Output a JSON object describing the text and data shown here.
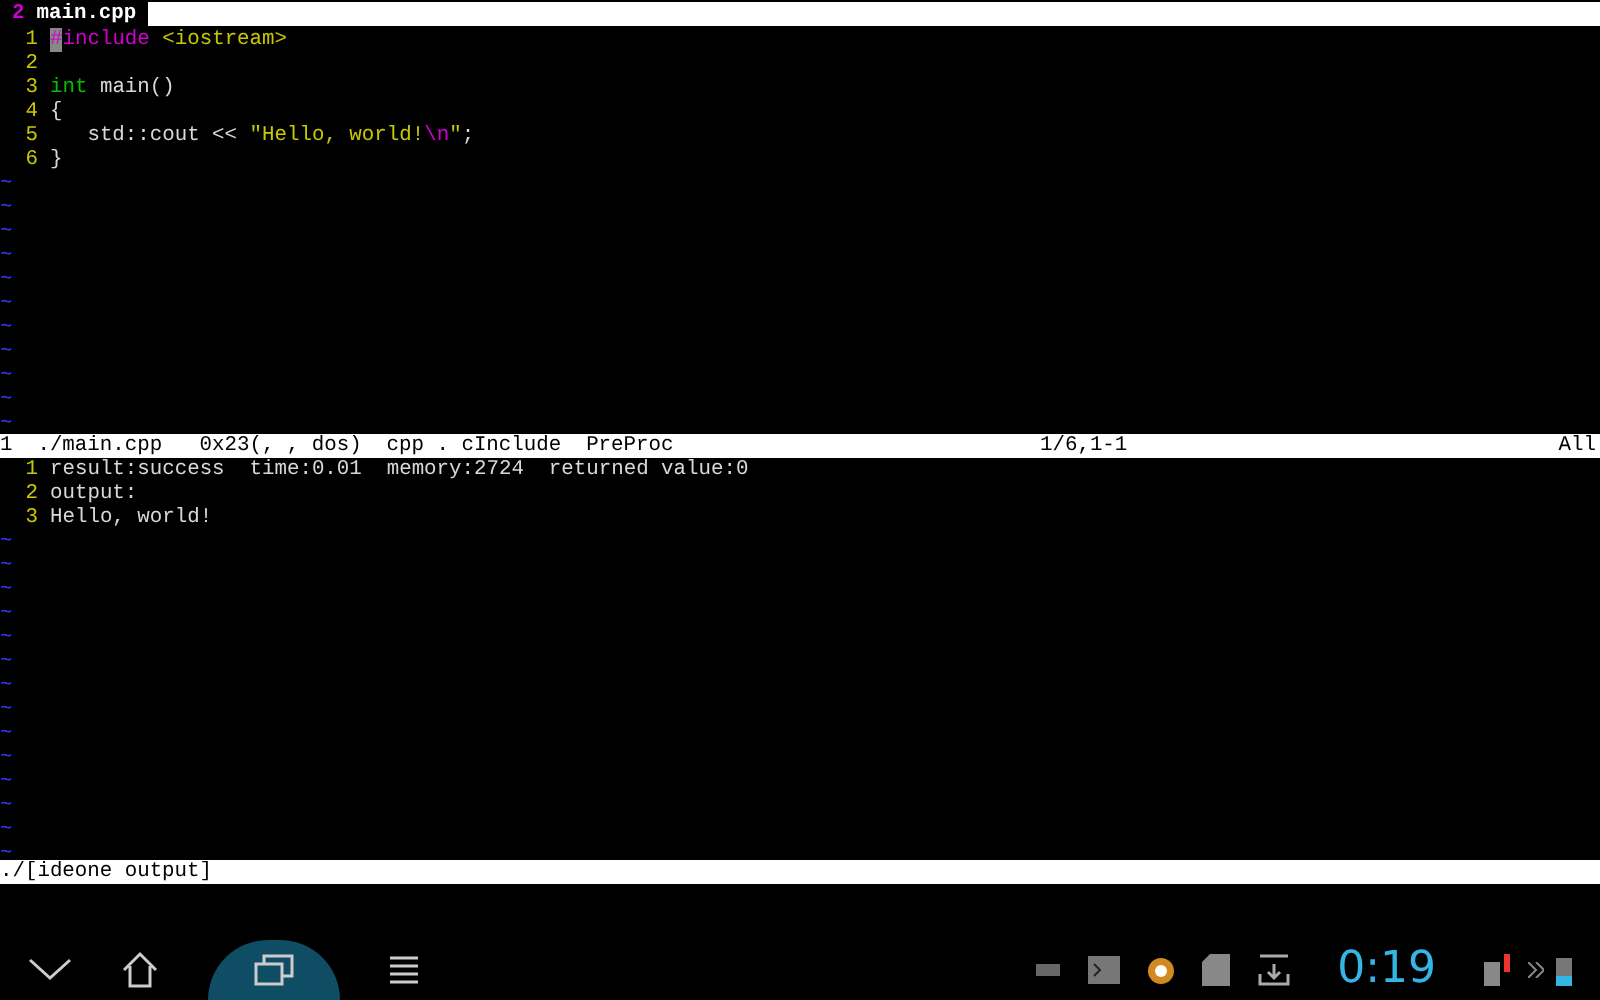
{
  "tabline": {
    "count": "2",
    "filename": "main.cpp"
  },
  "editor": {
    "lines": [
      {
        "number": "1",
        "segments": [
          {
            "kind": "cursor",
            "text": "#"
          },
          {
            "kind": "preproc",
            "text": "include"
          },
          {
            "kind": "string",
            "text": " <iostream>"
          }
        ]
      },
      {
        "number": "2"
      },
      {
        "number": "3",
        "segments": [
          {
            "kind": "type",
            "text": "int"
          },
          {
            "kind": "normal",
            "text": " main()"
          }
        ]
      },
      {
        "number": "4",
        "segments": [
          {
            "kind": "normal",
            "text": "{"
          }
        ]
      },
      {
        "number": "5",
        "segments": [
          {
            "kind": "normal",
            "text": "   std::cout << "
          },
          {
            "kind": "string",
            "text": "\"Hello, world!"
          },
          {
            "kind": "preproc",
            "text": "\\n"
          },
          {
            "kind": "string",
            "text": "\""
          },
          {
            "kind": "normal",
            "text": ";"
          }
        ]
      },
      {
        "number": "6",
        "segments": [
          {
            "kind": "normal",
            "text": "}"
          }
        ]
      }
    ],
    "filler": [
      "~",
      "~",
      "~",
      "~",
      "~",
      "~",
      "~",
      "~",
      "~",
      "~",
      "~"
    ],
    "status": {
      "buffer": "1",
      "file": "./main.cpp",
      "format": "0x23(, , dos)",
      "filetype": "cpp . cInclude",
      "syntax": "PreProc",
      "position": "1/6,1-1",
      "scroll": "All"
    }
  },
  "output": {
    "lines": [
      {
        "number": "1",
        "text": "result:success  time:0.01  memory:2724  returned value:0"
      },
      {
        "number": "2",
        "text": "output:"
      },
      {
        "number": "3",
        "text": "Hello, world!"
      }
    ],
    "filler": [
      "~",
      "~",
      "~",
      "~",
      "~",
      "~",
      "~",
      "~",
      "~",
      "~",
      "~",
      "~",
      "~",
      "~"
    ],
    "status": {
      "file": "./[ideone output]"
    }
  },
  "system_bar": {
    "clock": "0:19"
  }
}
